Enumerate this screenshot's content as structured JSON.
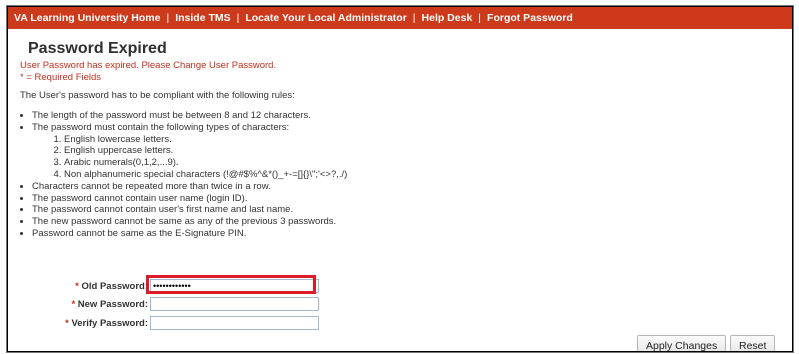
{
  "nav": {
    "links": [
      "VA Learning University Home",
      "Inside TMS",
      "Locate Your Local Administrator",
      "Help Desk",
      "Forgot Password"
    ],
    "separator": "|"
  },
  "page": {
    "title": "Password Expired",
    "error_message": "User Password has expired. Please Change User Password.",
    "required_note": "* = Required Fields",
    "intro": "The User's password has to be compliant with the following rules:"
  },
  "rules": {
    "length": "The length of the password must be between 8 and 12 characters.",
    "types_intro": "The password must contain the following types of characters:",
    "types": [
      "English lowercase letters.",
      "English uppercase letters.",
      "Arabic numerals(0,1,2,...9).",
      "Non alphanumeric special characters (!@#$%^&*()_+-=[]{}\\\";'<>?,./)"
    ],
    "others": [
      "Characters cannot be repeated more than twice in a row.",
      "The password cannot contain user name (login ID).",
      "The password cannot contain user's first name and last name.",
      "The new password cannot be same as any of the previous 3 passwords.",
      "Password cannot be same as the E-Signature PIN."
    ]
  },
  "form": {
    "required_mark": "*",
    "old_password_label": "Old Password:",
    "old_password_value": "••••••••••••",
    "new_password_label": "New Password:",
    "new_password_value": "",
    "verify_password_label": "Verify Password:",
    "verify_password_value": ""
  },
  "buttons": {
    "apply": "Apply Changes",
    "reset": "Reset"
  },
  "colors": {
    "nav_background": "#cc3a1b",
    "error_text": "#c0301e",
    "highlight_box": "#dd1c2a"
  }
}
